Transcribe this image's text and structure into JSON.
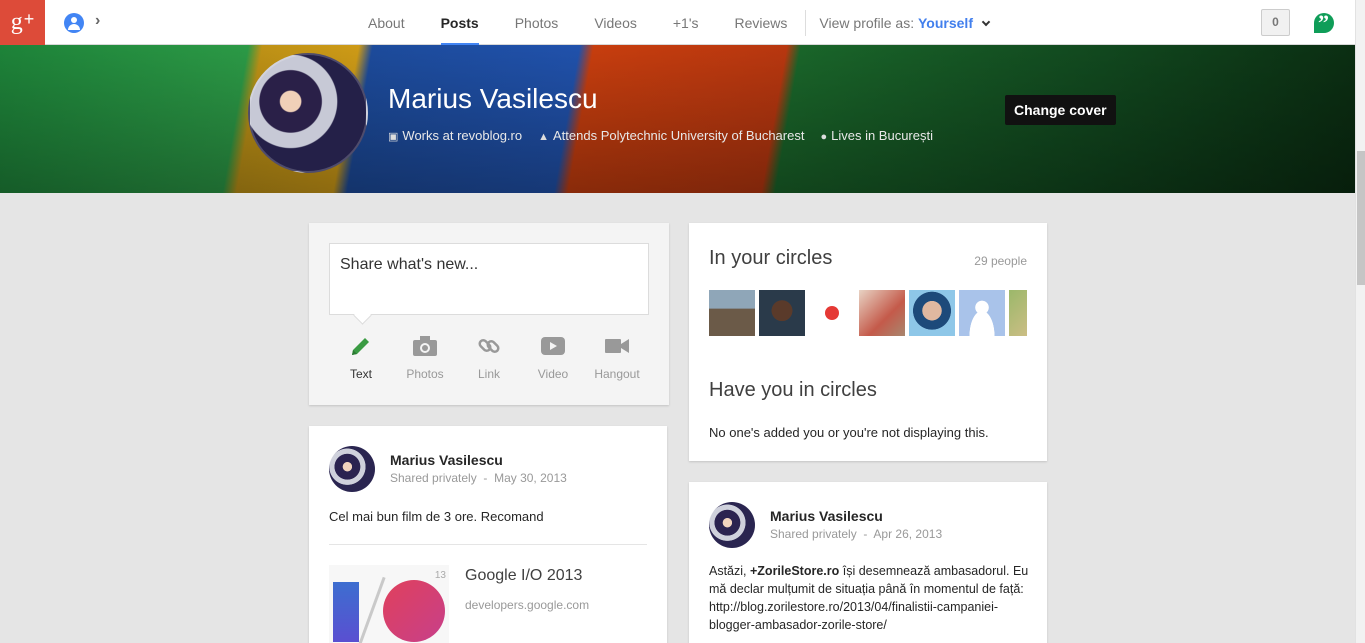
{
  "topbar": {
    "logo": "g+",
    "notifications_count": "0",
    "nav": [
      "About",
      "Posts",
      "Photos",
      "Videos",
      "+1's",
      "Reviews"
    ],
    "active_tab": "Posts",
    "view_profile_label": "View profile as:",
    "view_profile_value": "Yourself"
  },
  "cover": {
    "name": "Marius Vasilescu",
    "works": "Works at revoblog.ro",
    "attends": "Attends Polytechnic University of Bucharest",
    "lives": "Lives in București",
    "change_cover": "Change cover"
  },
  "share": {
    "placeholder": "Share what's new...",
    "actions": [
      "Text",
      "Photos",
      "Link",
      "Video",
      "Hangout"
    ]
  },
  "circles": {
    "title": "In your circles",
    "count": "29 people",
    "have_title": "Have you in circles",
    "have_text": "No one's added you or you're not displaying this."
  },
  "post1": {
    "author": "Marius Vasilescu",
    "visibility": "Shared privately",
    "date": "May 30, 2013",
    "text": "Cel mai bun film de 3 ore. Recomand",
    "link_title": "Google I/O 2013",
    "link_url": "developers.google.com",
    "thumb_badge": "13"
  },
  "post2": {
    "author": "Marius Vasilescu",
    "visibility": "Shared privately",
    "date": "Apr 26, 2013",
    "text_prefix": "Astăzi, ",
    "mention": "+ZorileStore.ro",
    "text_rest": " își desemnează ambasadorul. Eu mă declar mulțumit de situația până în momentul de față: http://blog.zorilestore.ro/2013/04/finalistii-campaniei-blogger-ambasador-zorile-store/"
  },
  "colors": {
    "brand_red": "#dd4b39",
    "accent_blue": "#427fed",
    "hangouts_green": "#0f9d58"
  }
}
